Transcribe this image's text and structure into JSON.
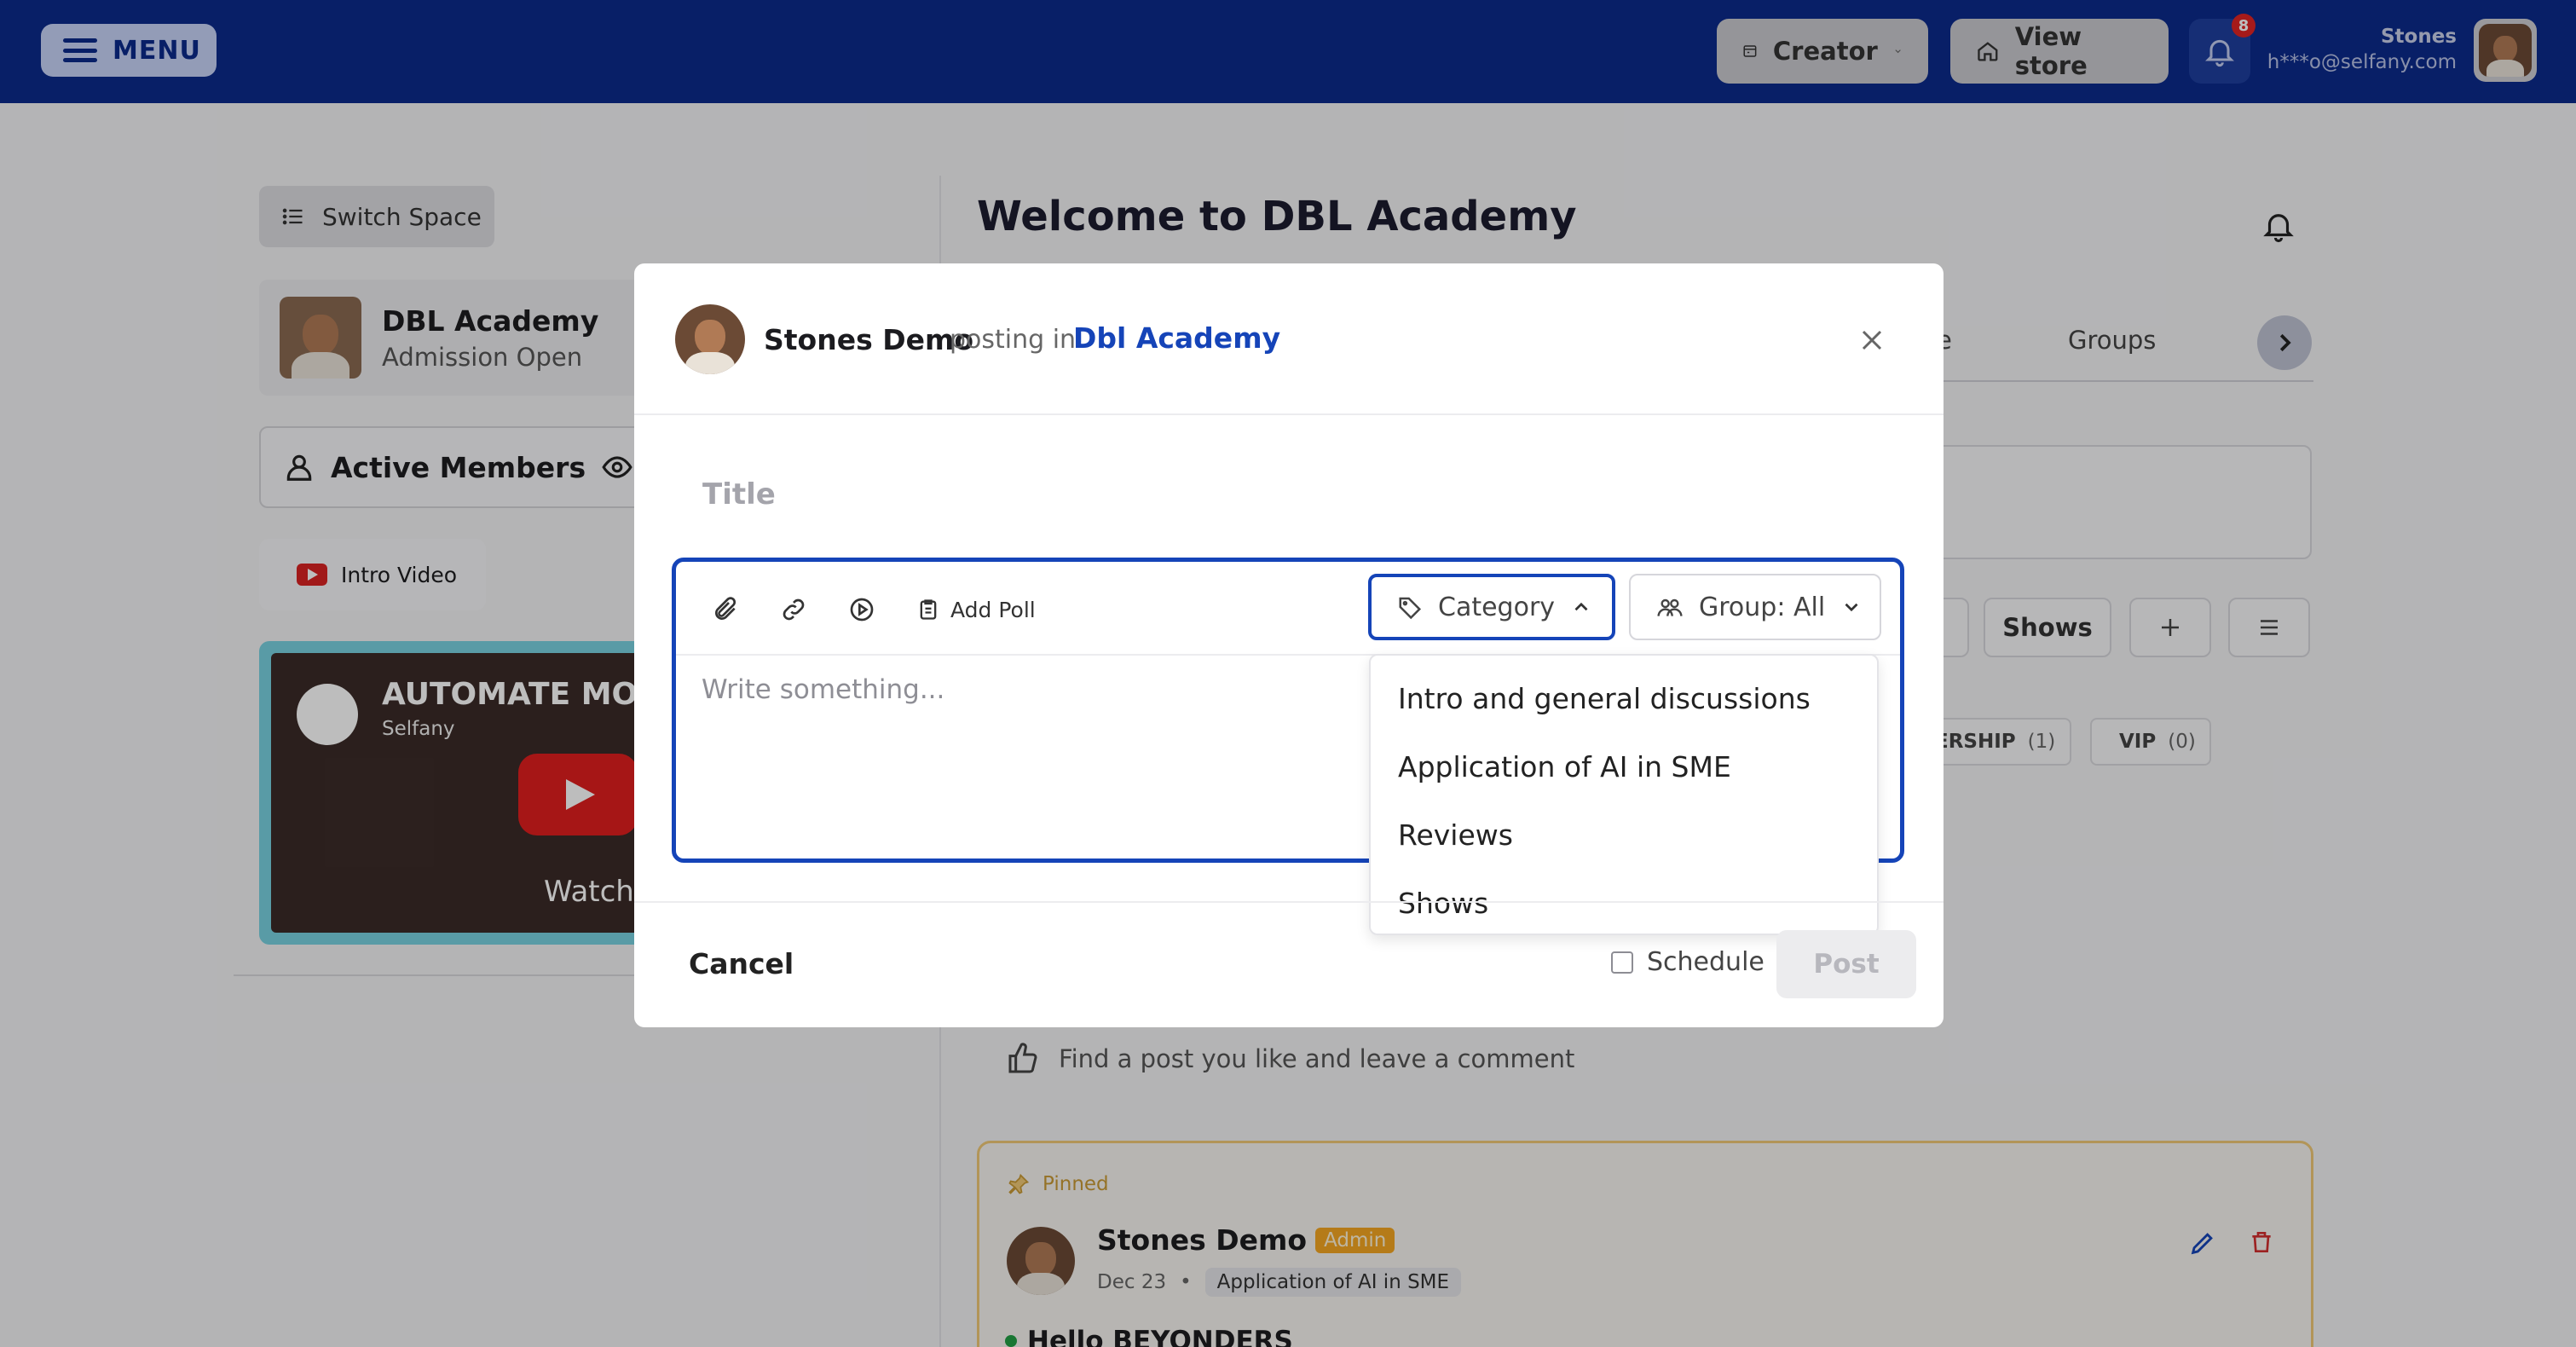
{
  "topbar": {
    "menu_label": "MENU",
    "creator_label": "Creator",
    "view_store_label": "View store",
    "notification_count": "8",
    "user_name": "Stones",
    "user_email": "h***o@selfany.com"
  },
  "sidebar": {
    "switch_space_label": "Switch Space",
    "academy_name": "DBL Academy",
    "academy_status": "Admission Open",
    "active_members_label": "Active Members",
    "intro_video_label": "Intro Video",
    "video_title": "AUTOMATE MORE",
    "video_channel": "Selfany",
    "video_watch": "Watch"
  },
  "main": {
    "welcome_title": "Welcome to DBL Academy",
    "tab_partial": "le",
    "tab_groups": "Groups",
    "chip_shows": "Shows",
    "tag_membership": "ERSHIP",
    "tag_membership_count": "(1)",
    "tag_vip": "VIP",
    "tag_vip_count": "(0)",
    "find_post_text": "Find a post you like and leave a comment",
    "pinned": {
      "label": "Pinned",
      "author": "Stones Demo",
      "badge": "Admin",
      "date": "Dec 23",
      "separator": "•",
      "category": "Application of AI in SME",
      "title": "Hello BEYONDERS"
    }
  },
  "modal": {
    "author": "Stones Demo",
    "posting_in": "posting in",
    "space": "Dbl Academy",
    "title_placeholder": "Title",
    "body_placeholder": "Write something...",
    "add_poll_label": "Add Poll",
    "category_label": "Category",
    "group_label": "Group: All",
    "dropdown_options": [
      "Intro and general discussions",
      "Application of AI in SME",
      "Reviews",
      "Shows"
    ],
    "cancel_label": "Cancel",
    "schedule_label": "Schedule",
    "post_label": "Post"
  },
  "colors": {
    "brand_blue": "#0b2a8c",
    "accent_blue": "#1544b8",
    "badge_red": "#e02424",
    "pinned_gold": "#f0c977"
  }
}
